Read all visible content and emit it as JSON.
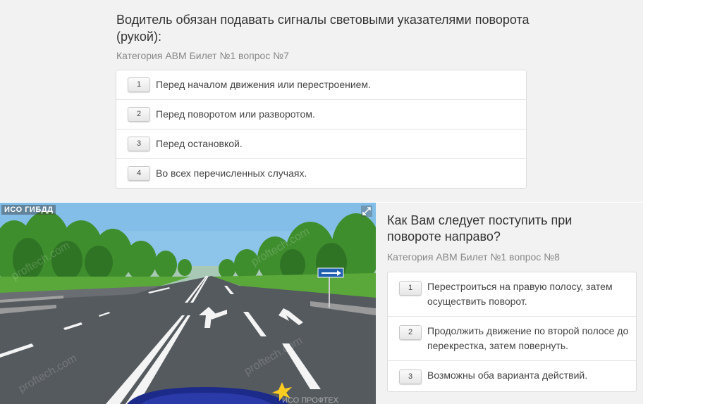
{
  "question1": {
    "title": "Водитель обязан подавать сигналы световыми указателями поворота (рукой):",
    "meta": "Категория ABM  Билет №1  вопрос №7",
    "answers": [
      {
        "num": "1",
        "text": "Перед началом движения или перестроением."
      },
      {
        "num": "2",
        "text": "Перед поворотом или разворотом."
      },
      {
        "num": "3",
        "text": "Перед остановкой."
      },
      {
        "num": "4",
        "text": "Во всех перечисленных случаях."
      }
    ]
  },
  "question2": {
    "title": "Как Вам следует поступить при повороте направо?",
    "meta": "Категория ABM  Билет №1  вопрос №8",
    "answers": [
      {
        "num": "1",
        "text": "Перестроиться на правую полосу, затем осуществить поворот."
      },
      {
        "num": "2",
        "text": "Продолжить движение по второй полосе до перекрестка, затем повернуть."
      },
      {
        "num": "3",
        "text": "Возможны оба варианта действий."
      }
    ]
  },
  "image": {
    "label": "ИСО  ГИБДД",
    "watermark": "proftech.com",
    "watermark_bottom": "ИСО ПРОФТЕХ"
  },
  "colors": {
    "panel_bg": "#f2f2f2",
    "road": "#555a5e",
    "sky": "#8cc4ea",
    "grass": "#5aa83a",
    "sign_blue": "#1f5fb0",
    "car": "#1c2a8a"
  },
  "icons": [
    "expand-icon"
  ]
}
